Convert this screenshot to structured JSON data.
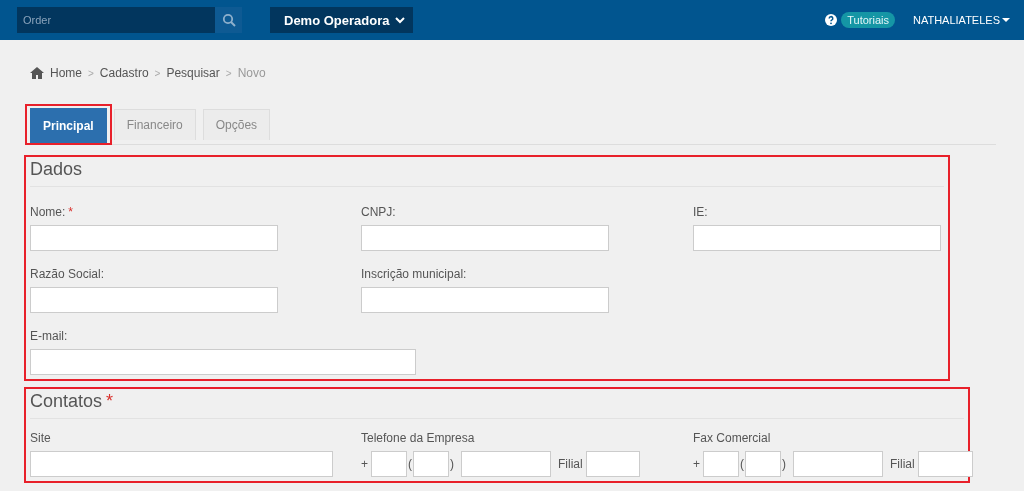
{
  "header": {
    "search": {
      "placeholder": "Order"
    },
    "operator_select": {
      "value": "Demo Operadora"
    },
    "help_badge": "Tutoriais",
    "user": "NATHALIATELES"
  },
  "breadcrumb": [
    {
      "label": "Home",
      "current": false
    },
    {
      "separator": ">",
      "label": "Cadastro",
      "current": false
    },
    {
      "separator": ">",
      "label": "Pesquisar",
      "current": false
    },
    {
      "separator": ">",
      "label": "Novo",
      "current": true
    }
  ],
  "tabs": [
    {
      "label": "Principal",
      "selected": true,
      "highlighted": true
    },
    {
      "label": "Financeiro",
      "selected": false,
      "highlighted": false
    },
    {
      "label": "Opções",
      "selected": false,
      "highlighted": false
    }
  ],
  "sections": [
    {
      "title": "Dados",
      "highlighted": true,
      "fields": [
        {
          "kind": "text",
          "label": "Nome:",
          "required_mark": "*"
        },
        {
          "kind": "text",
          "label": "CNPJ:"
        },
        {
          "kind": "text",
          "label": "IE:"
        },
        {
          "kind": "text",
          "label": "Razão Social:"
        },
        {
          "kind": "text",
          "label": "Inscrição municipal:"
        },
        {
          "kind": "break"
        },
        {
          "kind": "wide",
          "label": "E-mail:"
        }
      ]
    },
    {
      "title": "Contatos",
      "required_mark": "*",
      "highlighted": true,
      "fields": [
        {
          "kind": "text",
          "label": "Site"
        },
        {
          "kind": "phone",
          "label": "Telefone da Empresa",
          "plus": "+",
          "open": "(",
          "close": ")",
          "ext_label": "Filial"
        },
        {
          "kind": "phone",
          "label": "Fax Comercial",
          "plus": "+",
          "open": "(",
          "close": ")",
          "ext_label": "Filial"
        }
      ]
    }
  ]
}
